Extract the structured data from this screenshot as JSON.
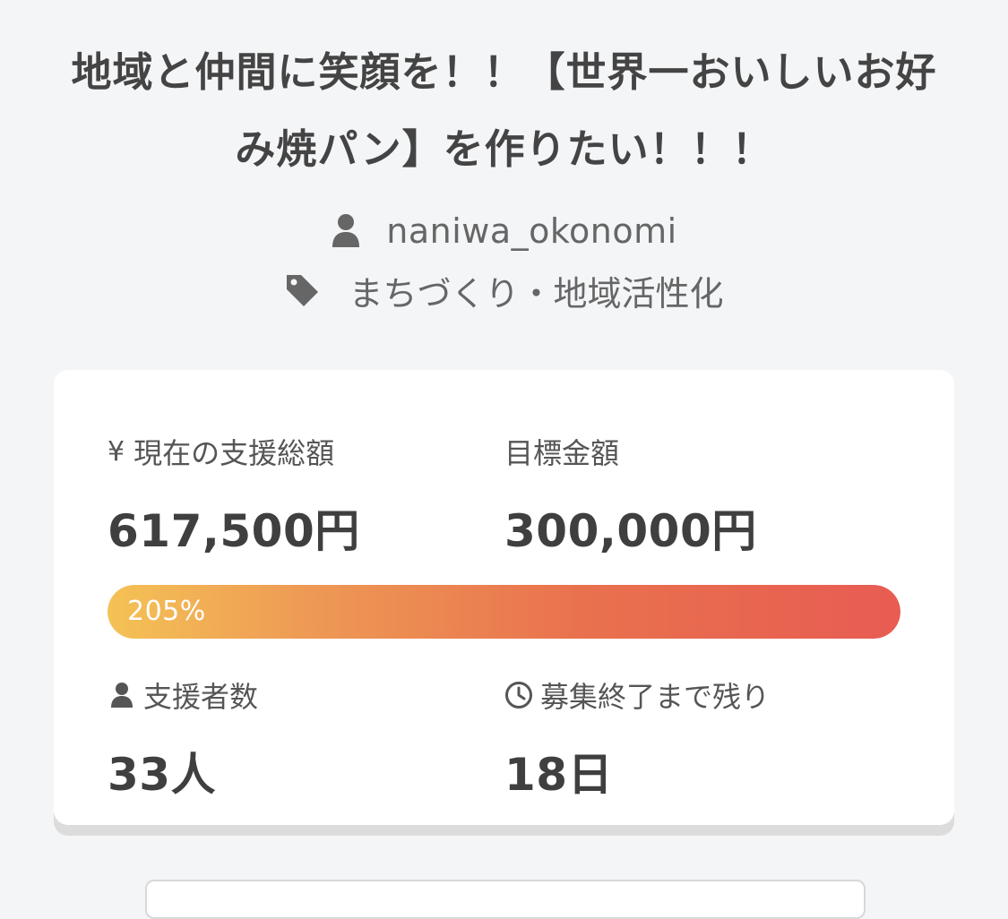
{
  "project": {
    "title": "地域と仲間に笑顔を！！【世界一おいしいお好み焼パン】を作りたい！！！",
    "owner": "naniwa_okonomi",
    "category": "まちづくり・地域活性化"
  },
  "icons": {
    "owner": "user-icon",
    "category": "tag-icon",
    "supporters": "user-icon",
    "remaining": "clock-icon"
  },
  "stats": {
    "current_label": "現在の支援総額",
    "current_symbol": "¥",
    "current_amount": "617,500円",
    "goal_label": "目標金額",
    "goal_amount": "300,000円",
    "progress_text": "205%",
    "progress_fraction": 1.0,
    "supporters_label": "支援者数",
    "supporters_count": "33人",
    "remaining_label": "募集終了まで残り",
    "remaining_days": "18日"
  },
  "colors": {
    "progress_start": "#f4c255",
    "progress_end": "#e85c52",
    "text_dark": "#3f3f3f",
    "background": "#f4f5f7"
  }
}
